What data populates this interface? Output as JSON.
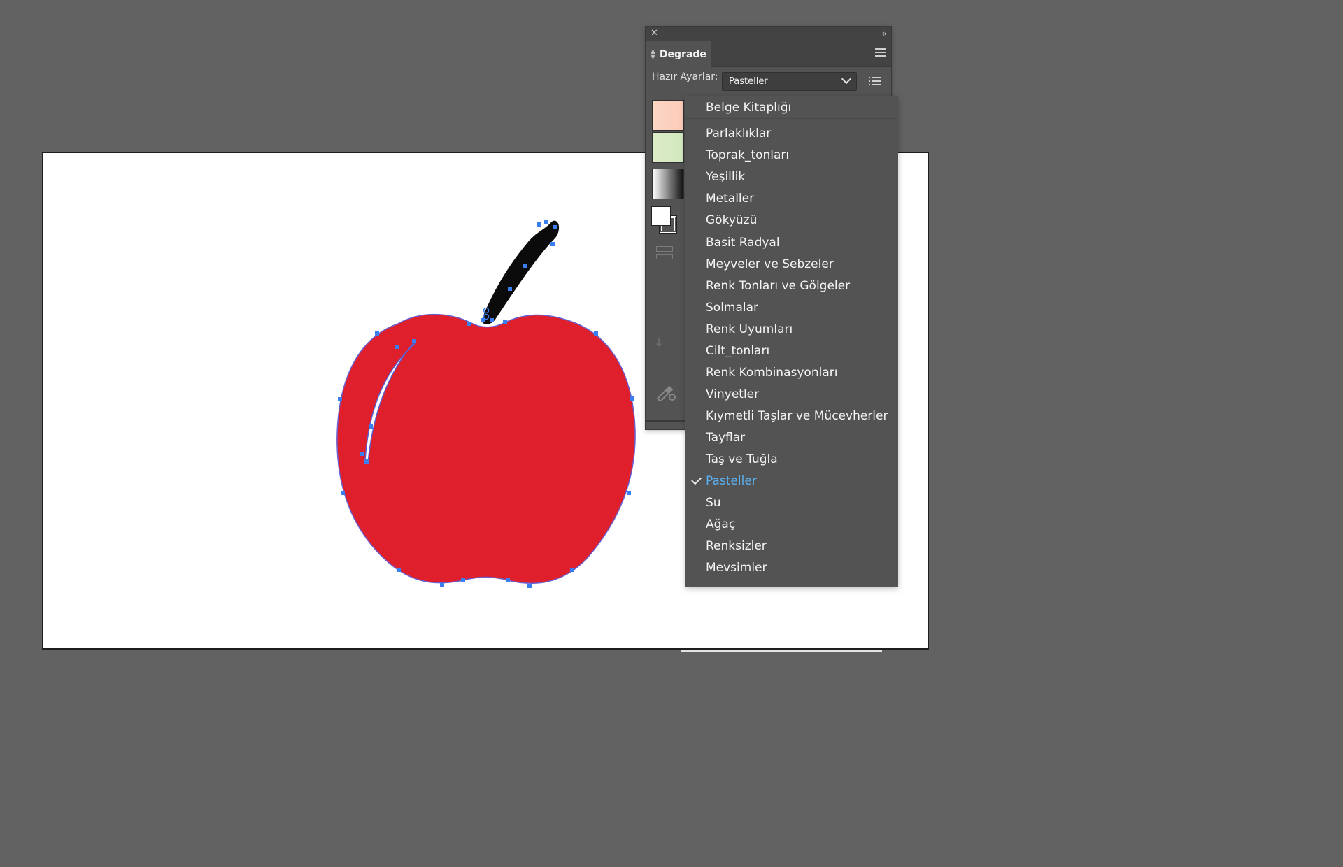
{
  "panel": {
    "title": "Degrade",
    "presets_label": "Hazır Ayarlar:",
    "presets_value": "Pasteller"
  },
  "icons": {
    "close": "close-icon",
    "collapse": "collapse-icon",
    "panel_menu": "hamburger-menu-icon",
    "list_view": "list-view-icon",
    "fill_stroke": "fill-stroke-icon",
    "save": "save-icon",
    "eyedropper": "eyedropper-icon"
  },
  "colors": {
    "apple_red": "#e01f2c",
    "stem": "#0b0b0b",
    "selection_anchor": "#3a7ef0",
    "menu_selected": "#5ab0f0",
    "app_background": "#626262"
  },
  "menu": {
    "items": [
      {
        "label": "Belge Kitaplığı",
        "selected": false
      },
      {
        "label": "Parlaklıklar",
        "selected": false
      },
      {
        "label": "Toprak_tonları",
        "selected": false
      },
      {
        "label": "Yeşillik",
        "selected": false
      },
      {
        "label": "Metaller",
        "selected": false
      },
      {
        "label": "Gökyüzü",
        "selected": false
      },
      {
        "label": "Basit Radyal",
        "selected": false
      },
      {
        "label": "Meyveler ve Sebzeler",
        "selected": false
      },
      {
        "label": "Renk Tonları ve Gölgeler",
        "selected": false
      },
      {
        "label": "Solmalar",
        "selected": false
      },
      {
        "label": "Renk Uyumları",
        "selected": false
      },
      {
        "label": "Cilt_tonları",
        "selected": false
      },
      {
        "label": "Renk Kombinasyonları",
        "selected": false
      },
      {
        "label": "Vinyetler",
        "selected": false
      },
      {
        "label": "Kıymetli Taşlar ve Mücevherler",
        "selected": false
      },
      {
        "label": "Tayflar",
        "selected": false
      },
      {
        "label": "Taş ve Tuğla",
        "selected": false
      },
      {
        "label": "Pasteller",
        "selected": true
      },
      {
        "label": "Su",
        "selected": false
      },
      {
        "label": "Ağaç",
        "selected": false
      },
      {
        "label": "Renksizler",
        "selected": false
      },
      {
        "label": "Mevsimler",
        "selected": false
      }
    ]
  }
}
